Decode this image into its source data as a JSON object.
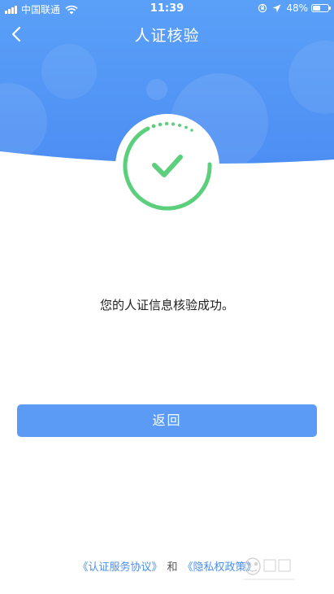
{
  "status_bar": {
    "carrier": "中国联通",
    "time": "11:39",
    "battery_percent": "48%",
    "battery_level": 0.48
  },
  "nav": {
    "title": "人证核验",
    "back_icon": "chevron-left-icon"
  },
  "result": {
    "icon": "success-check-icon",
    "message": "您的人证信息核验成功。"
  },
  "actions": {
    "back_label": "返回"
  },
  "footer": {
    "service_agreement": "《认证服务协议》",
    "conjunction": "和",
    "privacy_policy": "《隐私权政策》"
  },
  "colors": {
    "header_blue": "#5a9cf7",
    "header_blue_dark": "#4a8bf2",
    "button_blue": "#5b9bf5",
    "success_green": "#5ccf7d",
    "link_blue": "#4a8ef0"
  }
}
